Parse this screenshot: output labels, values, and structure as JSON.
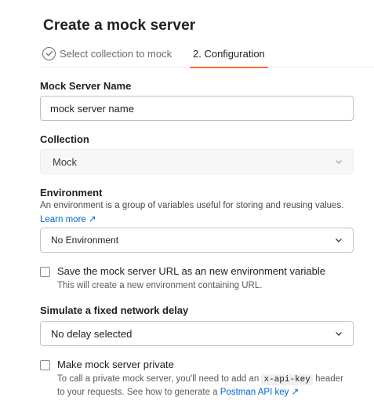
{
  "modal": {
    "title": "Create a mock server"
  },
  "tabs": [
    {
      "label": "Select collection to mock",
      "state": "completed"
    },
    {
      "label": "2. Configuration",
      "state": "active"
    }
  ],
  "colors": {
    "accent": "#ff6c37",
    "link": "#0265d2"
  },
  "mock_name": {
    "label": "Mock Server Name",
    "value": "mock server name"
  },
  "collection": {
    "label": "Collection",
    "value": "Mock"
  },
  "environment": {
    "label": "Environment",
    "description": "An environment is a group of variables useful for storing and reusing values.",
    "learn_more": "Learn more",
    "learn_more_icon": "↗",
    "value": "No Environment"
  },
  "save_url": {
    "label": "Save the mock server URL as an new environment variable",
    "help": "This will create a new environment containing URL.",
    "checked": false
  },
  "delay": {
    "label": "Simulate a fixed network delay",
    "value": "No delay selected"
  },
  "private": {
    "label": "Make mock server private",
    "help_1": "To call a private mock server, you'll need to add an",
    "help_code": "x-api-key",
    "help_2": "header",
    "help_3": "to your requests. See how to generate a",
    "help_link": "Postman API key",
    "help_link_icon": "↗",
    "checked": false
  }
}
